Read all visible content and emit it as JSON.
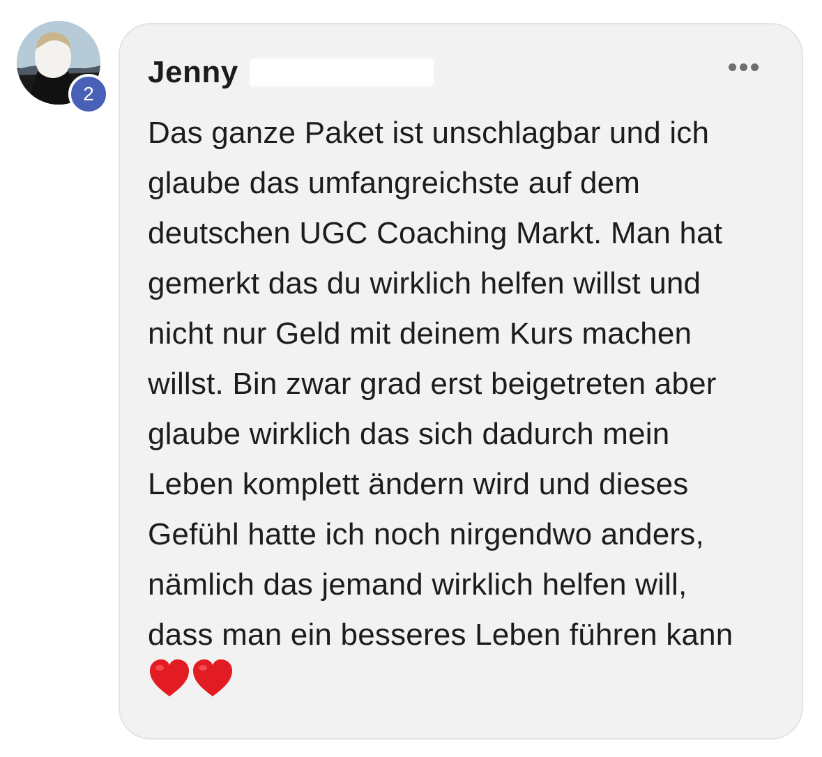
{
  "user": {
    "avatar_icon": "profile-photo",
    "badge_count": "2",
    "name": "Jenny"
  },
  "comment": {
    "lines": [
      "Das ganze Paket ist unschlagbar und ich",
      "glaube das umfangreichste auf dem",
      "deutschen UGC Coaching Markt. Man hat",
      "gemerkt das du wirklich helfen willst und",
      "nicht nur Geld mit deinem Kurs machen",
      "willst. Bin zwar grad erst beigetreten aber",
      "glaube wirklich das sich dadurch mein",
      "Leben komplett ändern wird und dieses",
      "Gefühl hatte ich noch nirgendwo anders,",
      "nämlich das jemand wirklich helfen will,",
      "dass man ein besseres Leben führen kann"
    ],
    "emoji": [
      "red-heart-icon",
      "red-heart-icon"
    ]
  },
  "colors": {
    "badge": "#4860b5",
    "bubble_bg": "#f3f2f2",
    "heart": "#e31b23"
  }
}
